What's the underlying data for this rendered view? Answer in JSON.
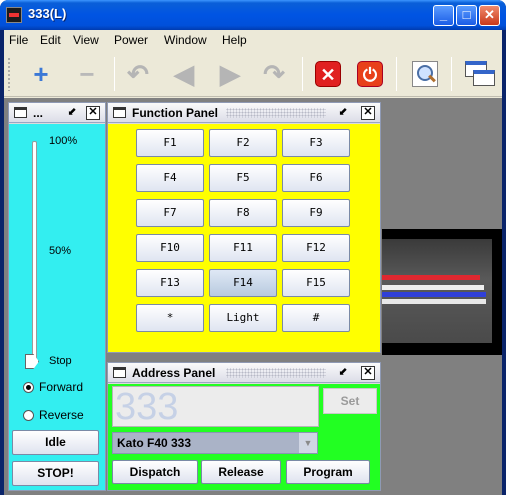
{
  "window": {
    "title": "333(L)"
  },
  "titlebar_buttons": {
    "minimize": "_",
    "maximize": "□",
    "close": "✕"
  },
  "menu": [
    "File",
    "Edit",
    "View",
    "Power",
    "Window",
    "Help"
  ],
  "toolbar": {
    "icons": [
      "plus-icon",
      "minus-icon",
      "rotate-left-icon",
      "arrow-left-icon",
      "arrow-right-icon",
      "rotate-right-icon",
      "stop-icon",
      "power-icon",
      "loupe-icon",
      "cascade-windows-icon"
    ],
    "glyphs": {
      "plus": "+",
      "minus": "−",
      "undo": "↶",
      "back": "◀",
      "forward": "▶",
      "redo": "↷",
      "stop": "✕",
      "power": "⏻"
    }
  },
  "throttle": {
    "title": "...",
    "ticks": [
      "100%",
      "50%",
      "Stop"
    ],
    "speed_fraction": 0,
    "direction": [
      {
        "label": "Forward",
        "selected": true
      },
      {
        "label": "Reverse",
        "selected": false
      }
    ],
    "idle_label": "Idle",
    "stop_label": "STOP!"
  },
  "function_panel": {
    "title": "Function Panel",
    "buttons": [
      "F1",
      "F2",
      "F3",
      "F4",
      "F5",
      "F6",
      "F7",
      "F8",
      "F9",
      "F10",
      "F11",
      "F12",
      "F13",
      "F14",
      "F15",
      "*",
      "Light",
      "#"
    ],
    "active": "F14"
  },
  "address_panel": {
    "title": "Address Panel",
    "address": "333",
    "set_label": "Set",
    "roster_selected": "Kato F40 333",
    "dispatch_label": "Dispatch",
    "release_label": "Release",
    "program_label": "Program"
  },
  "colors": {
    "throttle_bg": "#33eef0",
    "function_bg": "#ffff00",
    "address_bg": "#22ff22",
    "desktop_bg": "#808080"
  }
}
